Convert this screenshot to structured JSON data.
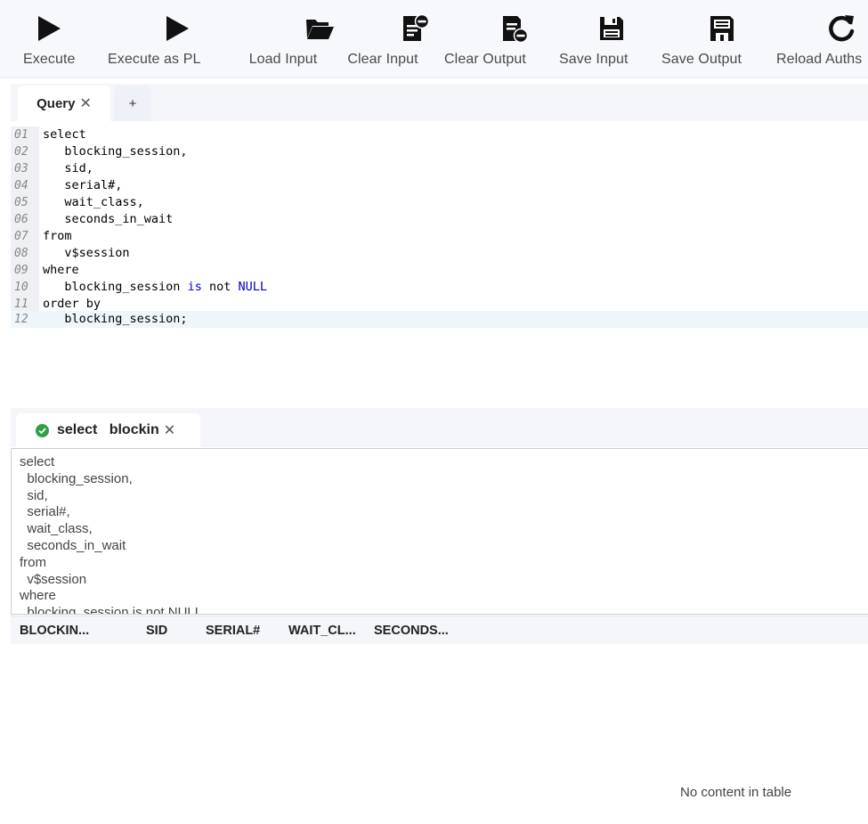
{
  "toolbar": {
    "buttons": [
      {
        "label": "Execute",
        "icon": "play-icon"
      },
      {
        "label": "Execute as PL",
        "icon": "play-icon"
      },
      {
        "label": "Load Input",
        "icon": "folder-open-icon"
      },
      {
        "label": "Clear Input",
        "icon": "file-minus-icon"
      },
      {
        "label": "Clear Output",
        "icon": "file-remove-icon"
      },
      {
        "label": "Save Input",
        "icon": "save-icon"
      },
      {
        "label": "Save Output",
        "icon": "save-output-icon"
      },
      {
        "label": "Reload Auths",
        "icon": "refresh-icon"
      }
    ]
  },
  "editor_tabs": {
    "active_label": "Query",
    "close_glyph": "✕",
    "add_label": "+"
  },
  "editor": {
    "lines": [
      {
        "num": "01",
        "text": "select"
      },
      {
        "num": "02",
        "text": "   blocking_session,"
      },
      {
        "num": "03",
        "text": "   sid,"
      },
      {
        "num": "04",
        "text": "   serial#,"
      },
      {
        "num": "05",
        "text": "   wait_class,"
      },
      {
        "num": "06",
        "text": "   seconds_in_wait"
      },
      {
        "num": "07",
        "text": "from"
      },
      {
        "num": "08",
        "text": "   v$session"
      },
      {
        "num": "09",
        "text": "where"
      },
      {
        "num": "10",
        "text": "   blocking_session is not NULL"
      },
      {
        "num": "11",
        "text": "order by"
      },
      {
        "num": "12",
        "text": "   blocking_session;"
      }
    ],
    "keyword_color": "#0000cc"
  },
  "result_tab": {
    "label": "select   blockin",
    "close_glyph": "✕",
    "status_icon": "check-circle-icon",
    "status_color": "#2e9e48"
  },
  "sql_echo": [
    "select",
    "  blocking_session,",
    "  sid,",
    "  serial#,",
    "  wait_class,",
    "  seconds_in_wait",
    "from",
    "  v$session",
    "where",
    "  blocking_session is not NULL"
  ],
  "result_table": {
    "columns": [
      "BLOCKIN...",
      "SID",
      "SERIAL#",
      "WAIT_CL...",
      "SECONDS..."
    ],
    "empty_message": "No content in table"
  }
}
